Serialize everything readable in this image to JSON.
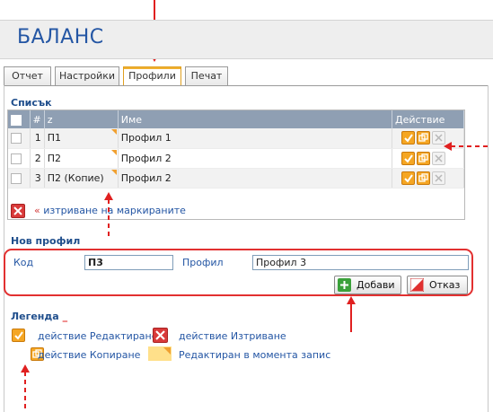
{
  "app": {
    "title": "БАЛАНС"
  },
  "tabs": [
    {
      "label": "Отчет",
      "active": false
    },
    {
      "label": "Настройки",
      "active": false
    },
    {
      "label": "Профили",
      "active": true
    },
    {
      "label": "Печат",
      "active": false
    }
  ],
  "list": {
    "title": "Списък",
    "columns": {
      "num": "#",
      "code": "z",
      "name": "Име",
      "action": "Действие"
    },
    "rows": [
      {
        "num": "1",
        "code": "П1",
        "name": "Профил 1"
      },
      {
        "num": "2",
        "code": "П2",
        "name": "Профил 2"
      },
      {
        "num": "3",
        "code": "П2 (Копие)",
        "name": "Профил 2"
      }
    ],
    "delete_prefix": "«",
    "delete_label": "изтриване на маркираните"
  },
  "new_profile": {
    "title": "Нов профил",
    "code_label": "Код",
    "code_value": "П3",
    "profile_label": "Профил",
    "profile_value": "Профил 3",
    "add_label": "Добави",
    "cancel_label": "Отказ"
  },
  "legend": {
    "title": "Легенда",
    "title_suffix": "_",
    "edit_label": "действие Редактиране",
    "delete_label": "действие Изтриване",
    "copy_label": "действие Копиране",
    "edited_label": "Редактиран в момента запис"
  },
  "icons": {
    "edit": "check-icon",
    "copy": "copy-icon",
    "delete": "delete-icon",
    "add": "plus-icon",
    "cancel": "cancel-icon"
  },
  "colors": {
    "accent": "#2456a4",
    "annotation": "#e02020",
    "action_orange": "#f5a623",
    "header_row": "#8f9fb3",
    "edited_highlight": "#ffe08a"
  }
}
